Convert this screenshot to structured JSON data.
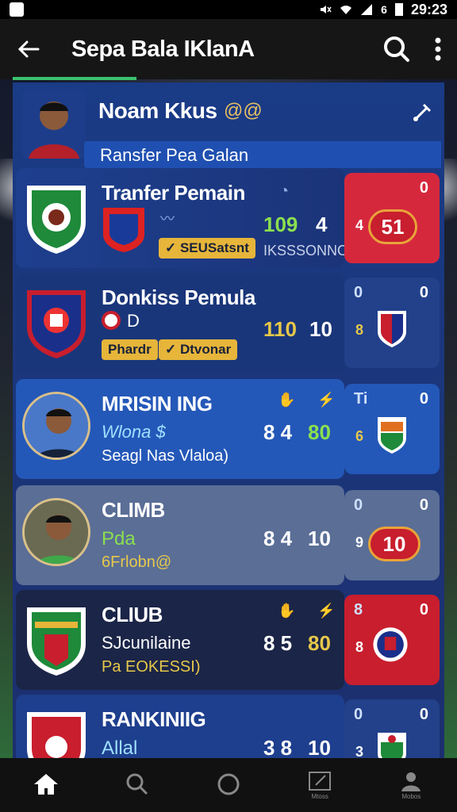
{
  "status_bar": {
    "time": "29:23",
    "battery_text": "6"
  },
  "app_bar": {
    "title": "Sepa Bala IKlanA"
  },
  "header": {
    "name": "Noam Kkus",
    "name_extra": "@@",
    "subtitle": "Ransfer Pea Galan"
  },
  "rows": [
    {
      "title": "Tranfer Pemain",
      "stat_a": "109",
      "stat_b": "4",
      "badge": "SEUSatsnt",
      "caption": "IKSSSONNO",
      "side_left": "",
      "side_right": "0",
      "side_num": "4",
      "pill": "51"
    },
    {
      "title": "Donkiss Pemula",
      "sub": "D",
      "stat_a": "110",
      "stat_b": "10",
      "badge1": "Phardr",
      "badge2": "Dtvonar",
      "side_left": "0",
      "side_right": "0",
      "side_num": "8"
    },
    {
      "title": "MRISIN ING",
      "sub": "Wlona $",
      "sub2": "Seagl Nas Vlaloa)",
      "stat_a": "8 4",
      "stat_b": "80",
      "side_left": "Ti",
      "side_right": "0",
      "side_num": "6"
    },
    {
      "title": "CLIMB",
      "sub": "Pda",
      "sub2": "6Frlobn@",
      "stat_a": "8 4",
      "stat_b": "10",
      "side_left": "0",
      "side_right": "0",
      "side_num": "9",
      "pill": "10"
    },
    {
      "title": "CLIUB",
      "sub": "SJcunilaine",
      "sub2": "Pa EOKESSI)",
      "stat_a": "8 5",
      "stat_b": "80",
      "side_left": "8",
      "side_right": "0",
      "side_num": "8"
    },
    {
      "title": "RANKINIIG",
      "sub": "Allal",
      "stat_a": "3 8",
      "stat_b": "10",
      "side_left": "0",
      "side_right": "0",
      "side_num": "3"
    }
  ],
  "bottom_nav": {
    "items": [
      {
        "icon": "home-icon",
        "label": ""
      },
      {
        "icon": "search-icon",
        "label": ""
      },
      {
        "icon": "circle-icon",
        "label": ""
      },
      {
        "icon": "edit-icon",
        "label": "Mtoss"
      },
      {
        "icon": "profile-icon",
        "label": "Mobos"
      }
    ]
  },
  "colors": {
    "accent_green": "#3ac26e",
    "pill_red": "#c81e2e",
    "stat_green": "#8be04e",
    "stat_yellow": "#e6c84a",
    "badge_gold": "#e6b53a"
  }
}
